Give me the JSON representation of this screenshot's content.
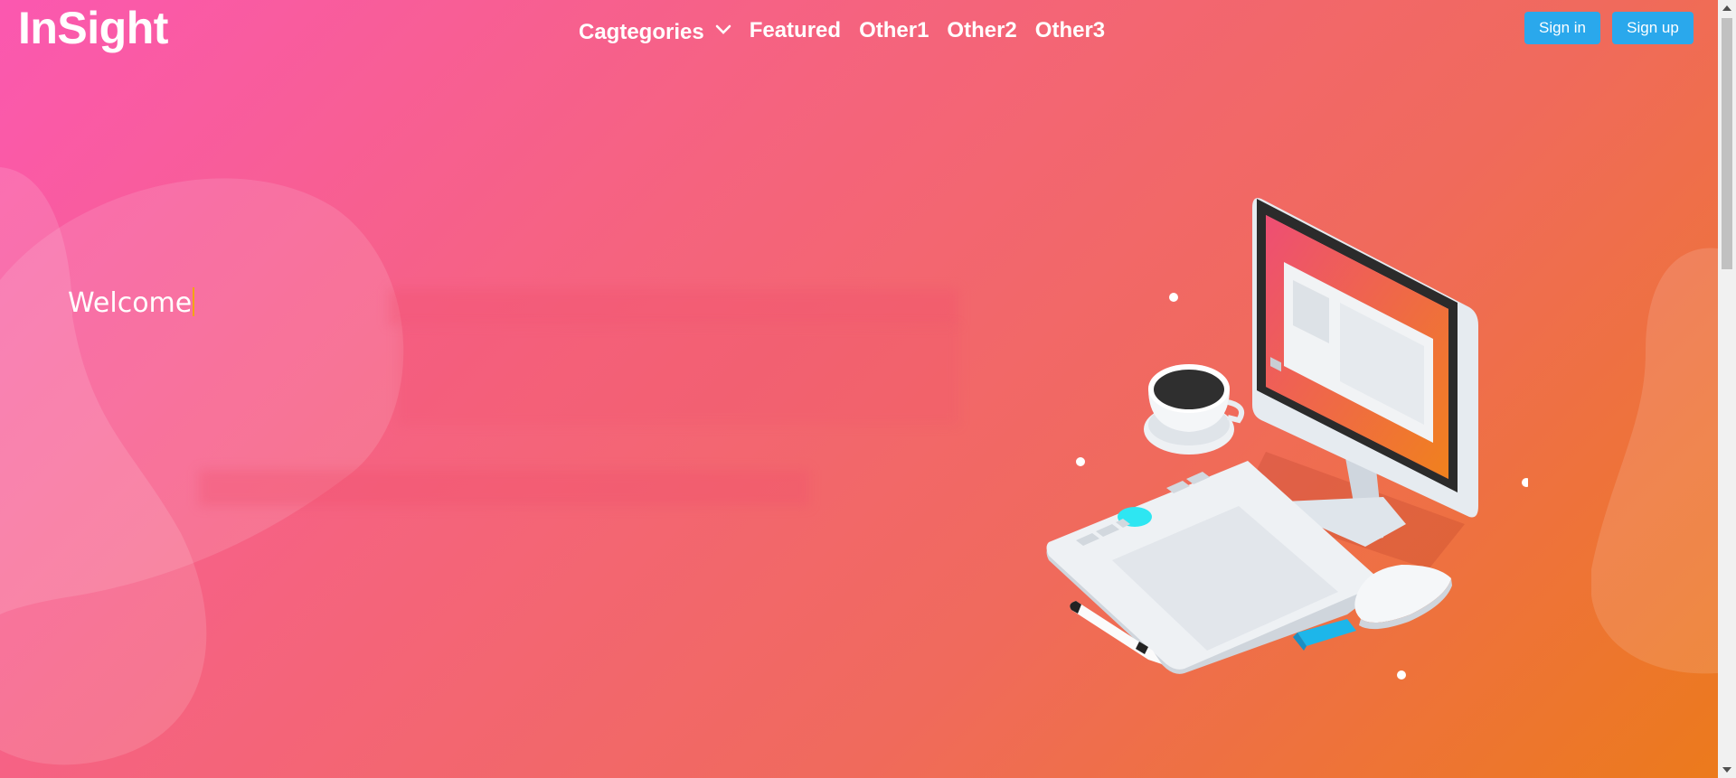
{
  "brand": {
    "logo": "InSight"
  },
  "nav": {
    "categories": "Cagtegories",
    "featured": "Featured",
    "other1": "Other1",
    "other2": "Other2",
    "other3": "Other3"
  },
  "auth": {
    "sign_in": "Sign in",
    "sign_up": "Sign up"
  },
  "hero": {
    "welcome": "Welcome",
    "illustration": "desk-computer-illustration"
  },
  "colors": {
    "gradient_start": "#fb58b0",
    "gradient_end": "#ec7a1c",
    "button": "#2aa8ec",
    "caret": "#f3a50e"
  }
}
